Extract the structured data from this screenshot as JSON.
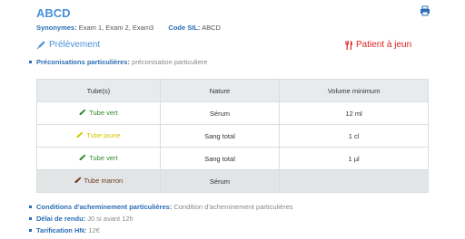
{
  "header": {
    "title": "ABCD",
    "synonymes_label": "Synonymes:",
    "synonymes_value": "Exam 1, Exam 2, Exam3",
    "code_sil_label": "Code SIL:",
    "code_sil_value": "ABCD"
  },
  "section": {
    "prelevement_label": "Prélèvement",
    "fasting_label": "Patient à jeun"
  },
  "preconisations": {
    "label": "Préconisations particulières:",
    "value": "préconisation particuliere"
  },
  "table": {
    "headers": [
      "Tube(s)",
      "Nature",
      "Volume minimum"
    ],
    "rows": [
      {
        "tube": "Tube vert",
        "tube_color": "#2e8b2e",
        "nature": "Sérum",
        "volume": "12 ml"
      },
      {
        "tube": "Tube jaune",
        "tube_color": "#d4c800",
        "nature": "Sang total",
        "volume": "1 cl"
      },
      {
        "tube": "Tube vert",
        "tube_color": "#2e8b2e",
        "nature": "Sang total",
        "volume": "1 µl"
      },
      {
        "tube": "Tube marron",
        "tube_color": "#6b3a1e",
        "nature": "Sérum",
        "volume": ""
      }
    ]
  },
  "footer": {
    "conditions_label": "Conditions d'acheminement particulières:",
    "conditions_value": "Condition d'acheminement particulières",
    "delai_label": "Délai de rendu:",
    "delai_value": "J0 si avant 12h",
    "tarif_label": "Tarification HN:",
    "tarif_value": "12€"
  },
  "colors": {
    "accent": "#4a90d9",
    "label_blue": "#2a6db5",
    "fasting_red": "#e02020",
    "header_bg": "#e8ebee"
  },
  "icons": {
    "print": "print-icon",
    "prelevement": "syringe-icon",
    "fasting": "utensils-icon",
    "tube": "test-tube-icon"
  }
}
